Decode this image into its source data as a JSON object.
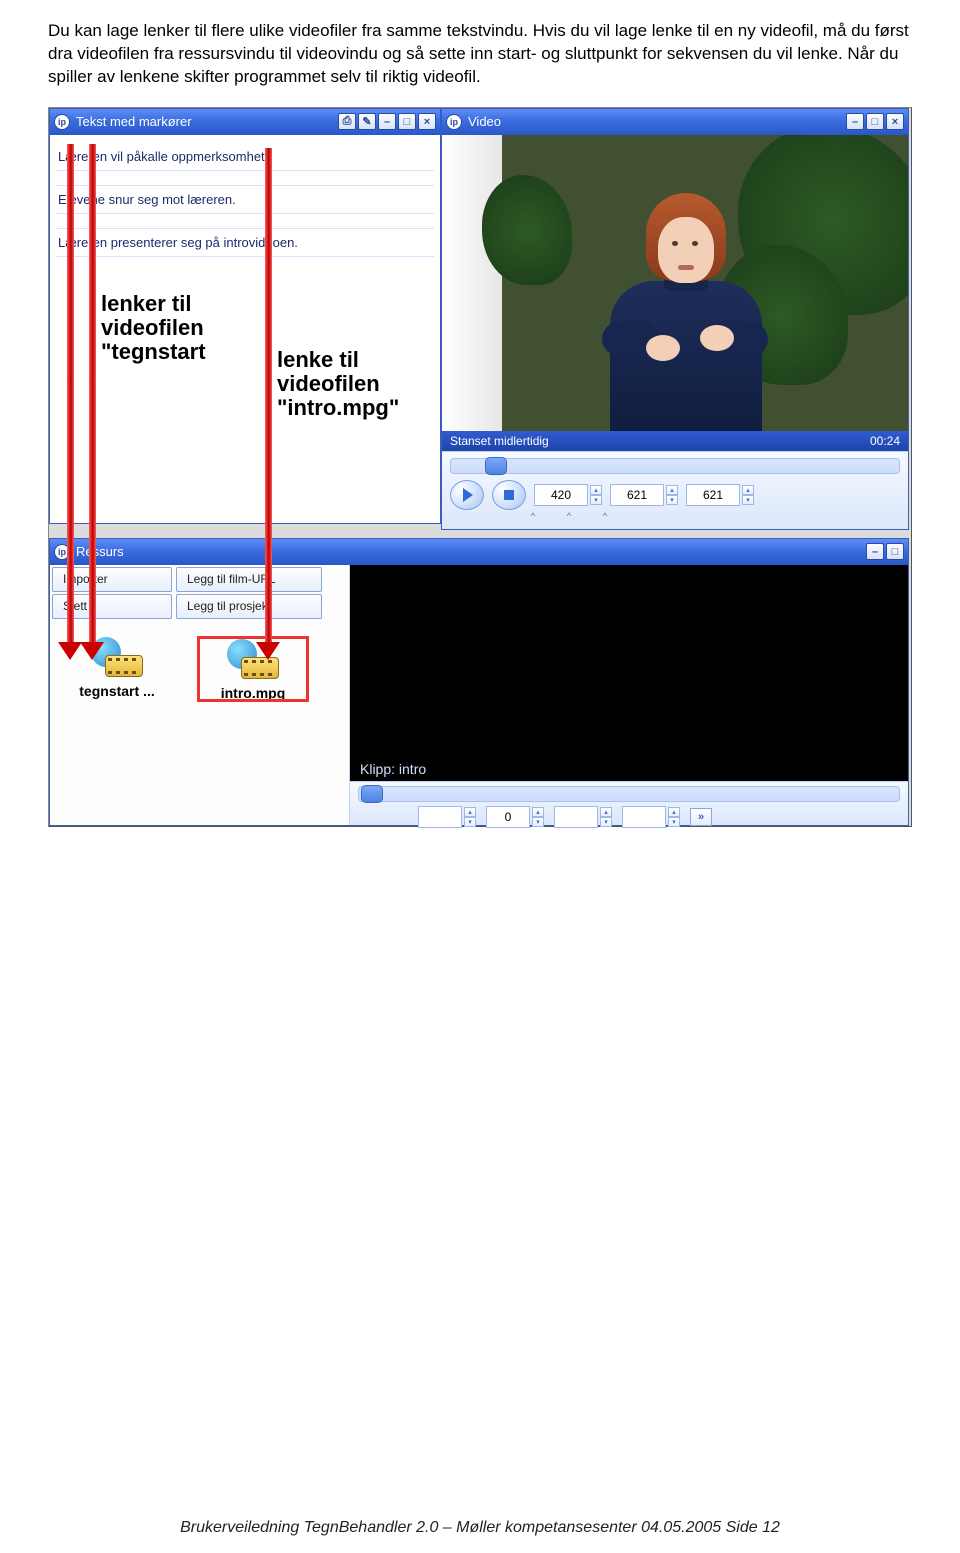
{
  "intro": "Du kan lage lenker til flere ulike videofiler fra samme tekstvindu. Hvis du vil lage lenke til en ny videofil, må du først dra videofilen fra ressursvindu til videovindu og så sette inn start- og sluttpunkt for sekvensen du vil lenke. Når du spiller av lenkene skifter programmet selv til riktig videofil.",
  "textWin": {
    "title": "Tekst med markører",
    "lines": [
      "Læreren vil påkalle oppmerksomhet.",
      "Elevene snur seg mot læreren.",
      "Læreren presenterer seg på introvideoen."
    ]
  },
  "annot1": "lenker til\nvideofilen\n\"tegnstart",
  "annot2": "lenke til\nvideofilen\n\"intro.mpg\"",
  "videoWin": {
    "title": "Video",
    "status": "Stanset midlertidig",
    "time": "00:24",
    "frames": [
      "420",
      "621",
      "621"
    ]
  },
  "resWin": {
    "title": "Ressurs",
    "buttons": [
      "Importer",
      "Legg til film-URL",
      "Slett",
      "Legg til prosjekt"
    ],
    "thumbs": [
      "tegnstart ...",
      "intro.mpg"
    ],
    "clip": "Klipp: intro",
    "num": "0"
  },
  "footer": "Brukerveiledning TegnBehandler 2.0 – Møller kompetansesenter 04.05.2005   Side 12"
}
